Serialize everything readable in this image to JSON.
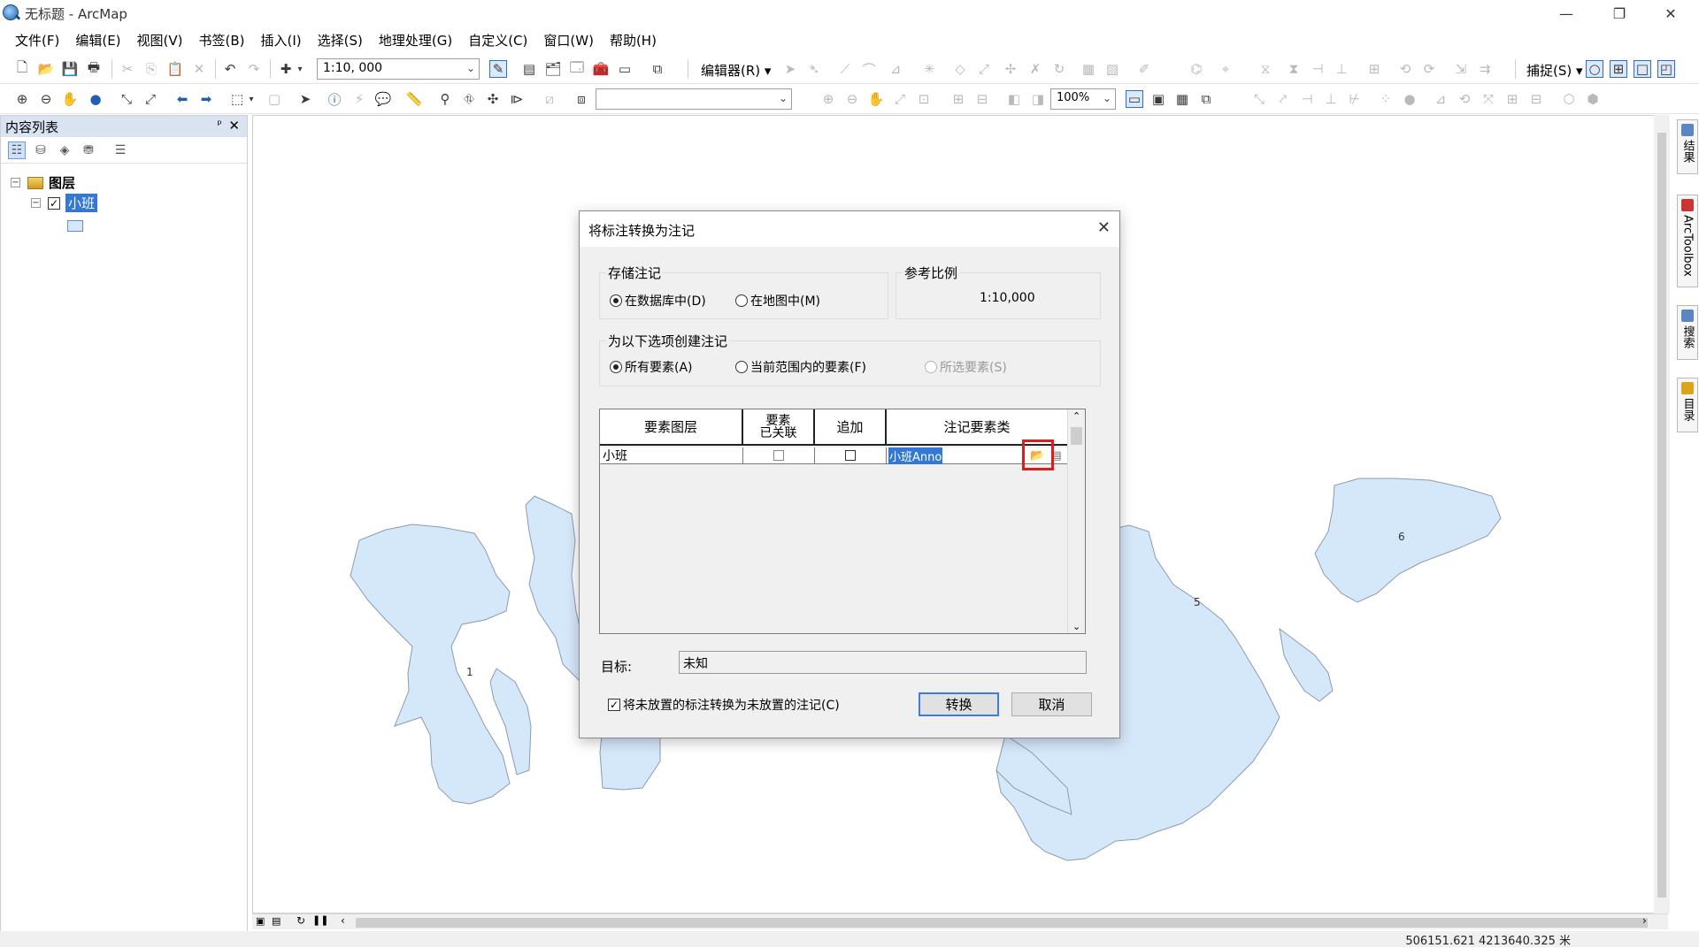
{
  "window": {
    "title": "无标题 - ArcMap",
    "controls": {
      "minimize": "—",
      "restore": "❐",
      "close": "✕"
    }
  },
  "menu": [
    "文件(F)",
    "编辑(E)",
    "视图(V)",
    "书签(B)",
    "插入(I)",
    "选择(S)",
    "地理处理(G)",
    "自定义(C)",
    "窗口(W)",
    "帮助(H)"
  ],
  "toolbar": {
    "scale_value": "1:10, 000",
    "editor_label": "编辑器(R)",
    "snap_label": "捕捉(S)",
    "zoom_percent": "100%",
    "dropdown_arrow": "▾"
  },
  "toc": {
    "title": "内容列表",
    "pin": "ᵖ",
    "close": "✕",
    "root_label": "图层",
    "layer_label": "小班",
    "expand_symbol": "⊟",
    "check_mark": "✓"
  },
  "map": {
    "polygon_labels": [
      "1",
      "5",
      "6"
    ],
    "fill_color": "#d5e8fa",
    "stroke_color": "#8a9cb0"
  },
  "dock_tabs": [
    "结果",
    "ArcToolbox",
    "搜索",
    "目录"
  ],
  "status": {
    "coordinates": "506151.621  4213640.325 米"
  },
  "dialog": {
    "title": "将标注转换为注记",
    "close": "✕",
    "store_group": {
      "label": "存储注记",
      "options": [
        {
          "label": "在数据库中(D)",
          "selected": true
        },
        {
          "label": "在地图中(M)",
          "selected": false
        }
      ]
    },
    "ref_scale": {
      "label": "参考比例",
      "value": "1:10,000"
    },
    "create_group": {
      "label": "为以下选项创建注记",
      "options": [
        {
          "label": "所有要素(A)",
          "selected": true
        },
        {
          "label": "当前范围内的要素(F)",
          "selected": false
        },
        {
          "label": "所选要素(S)",
          "selected": false,
          "disabled": true
        }
      ]
    },
    "grid": {
      "headers": [
        "要素图层",
        "要素\n已关联",
        "追加",
        "注记要素类"
      ],
      "rows": [
        {
          "layer": "小班",
          "linked": false,
          "append": false,
          "anno_class": "小班Anno"
        }
      ]
    },
    "target_label": "目标:",
    "target_value": "未知",
    "unplaced_checkbox": {
      "label": "将未放置的标注转换为未放置的注记(C)",
      "checked": true
    },
    "convert_button": "转换",
    "cancel_button": "取消"
  }
}
